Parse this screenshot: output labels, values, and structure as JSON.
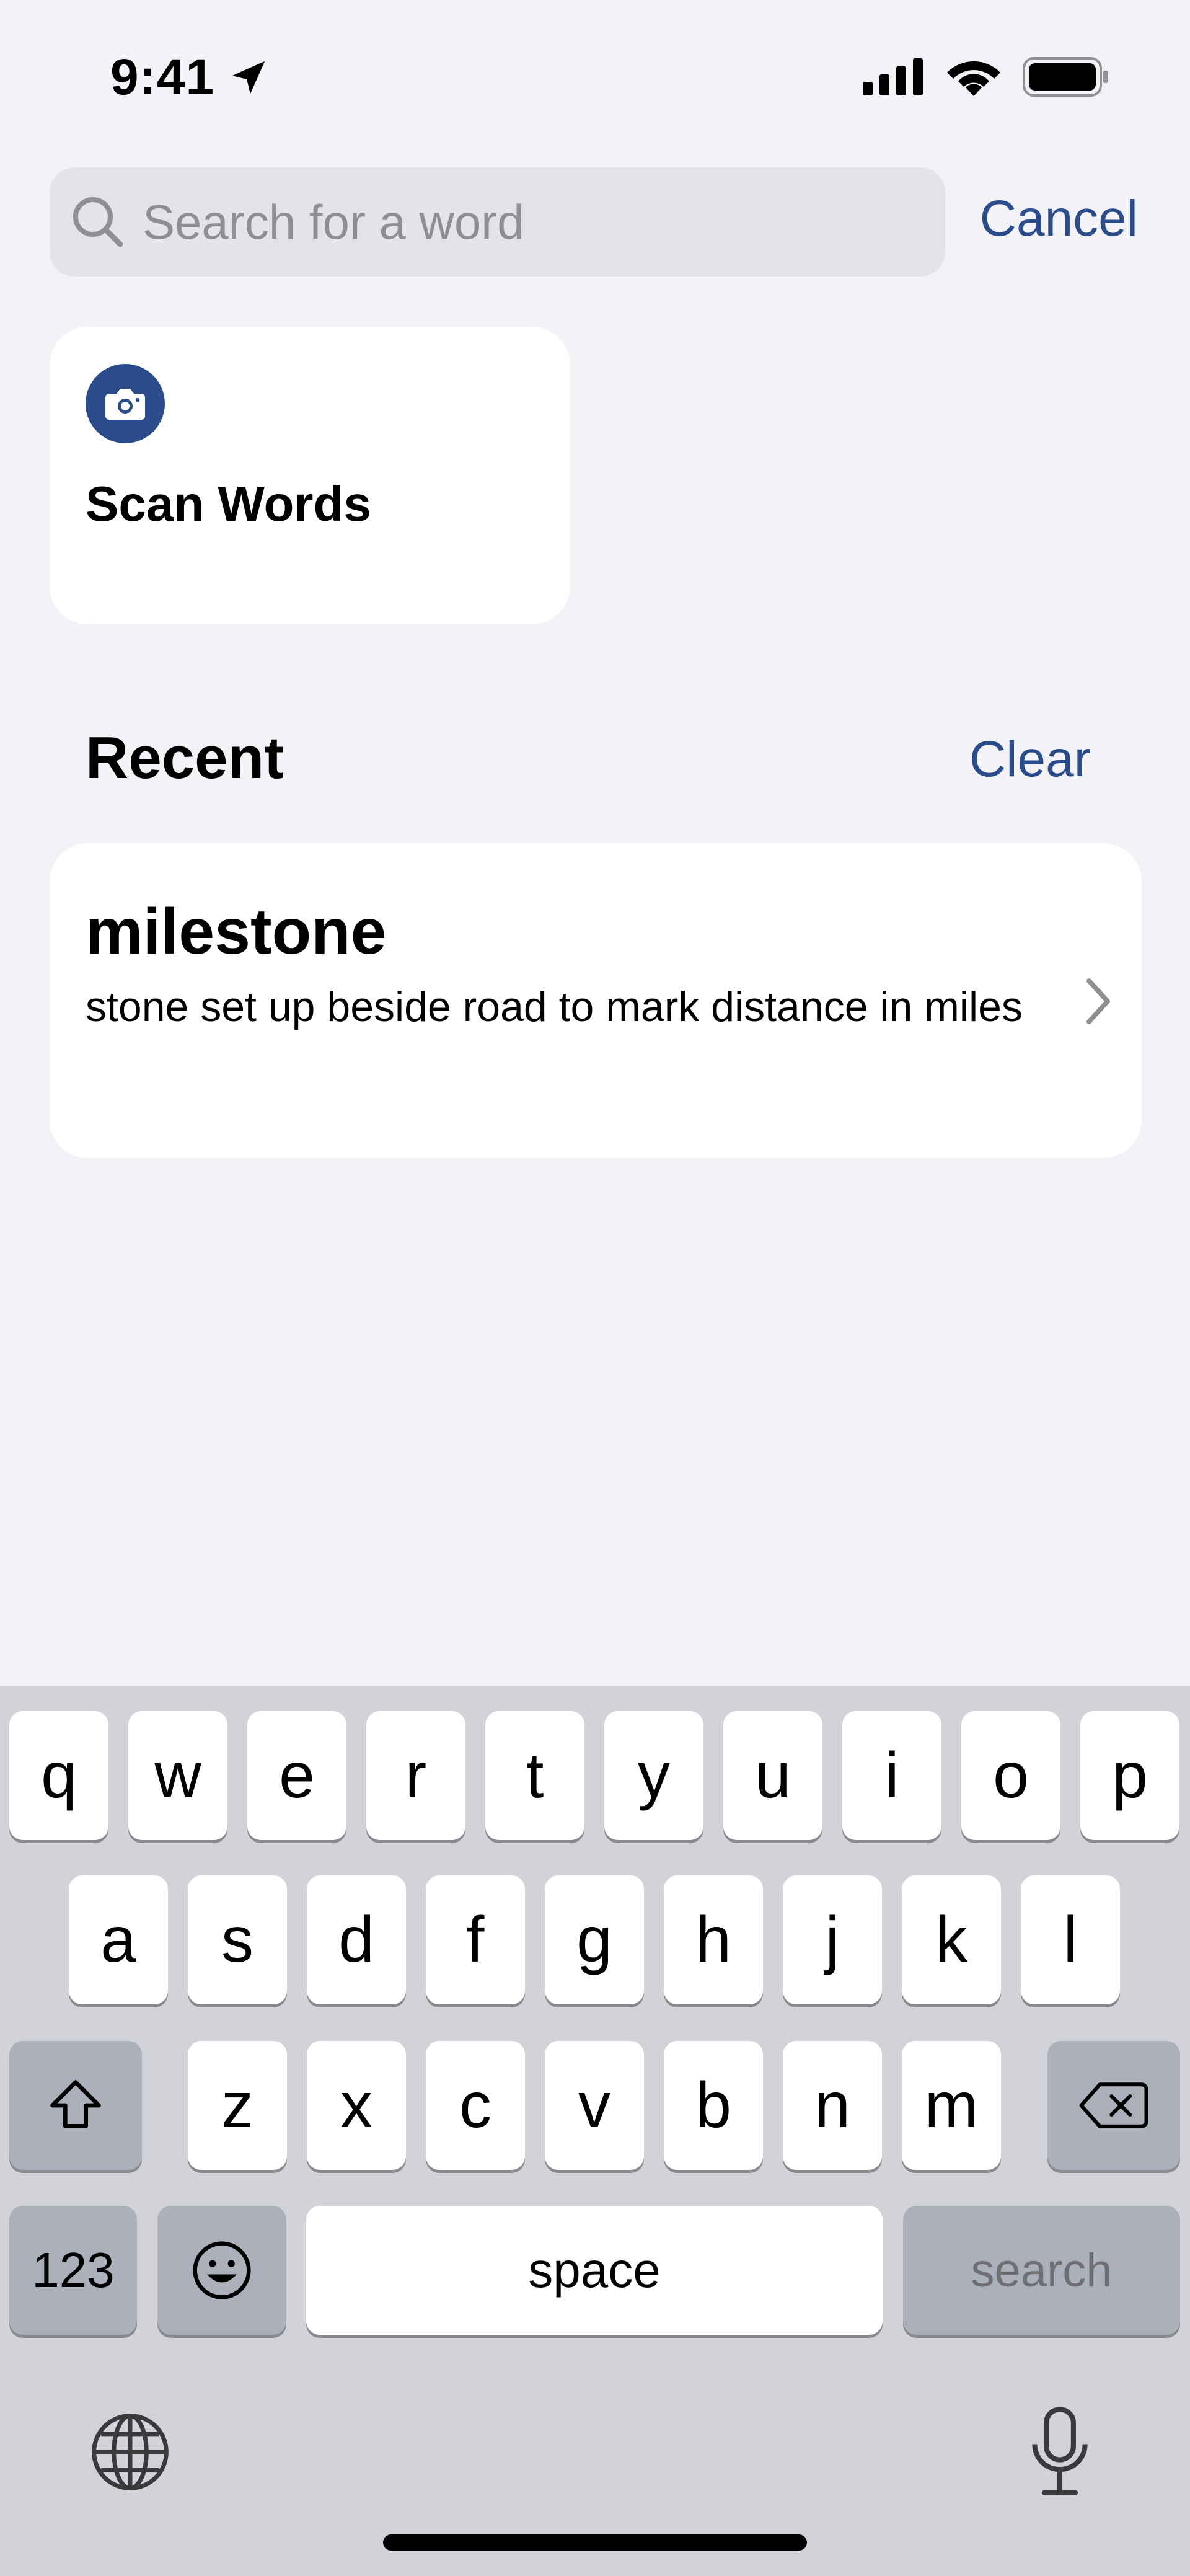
{
  "status_bar": {
    "time": "9:41",
    "icons": [
      "location-arrow-icon",
      "cellular-signal-icon",
      "wifi-icon",
      "battery-icon"
    ]
  },
  "search": {
    "placeholder": "Search for a word",
    "value": "",
    "icon": "search-icon",
    "cancel_label": "Cancel"
  },
  "scan_card": {
    "label": "Scan Words",
    "icon": "camera-icon"
  },
  "recent": {
    "title": "Recent",
    "clear_label": "Clear",
    "items": [
      {
        "word": "milestone",
        "definition": "stone set up beside road to mark distance in miles"
      }
    ]
  },
  "keyboard": {
    "row1": [
      "q",
      "w",
      "e",
      "r",
      "t",
      "y",
      "u",
      "i",
      "o",
      "p"
    ],
    "row2": [
      "a",
      "s",
      "d",
      "f",
      "g",
      "h",
      "j",
      "k",
      "l"
    ],
    "row3": [
      "z",
      "x",
      "c",
      "v",
      "b",
      "n",
      "m"
    ],
    "numbers_label": "123",
    "space_label": "space",
    "return_label": "search",
    "icons": [
      "shift-icon",
      "delete-icon",
      "emoji-icon",
      "globe-icon",
      "microphone-icon"
    ]
  },
  "colors": {
    "accent": "#2b4c8c",
    "background": "#f2f2f7",
    "keyboard_background": "#d1d3d9"
  }
}
